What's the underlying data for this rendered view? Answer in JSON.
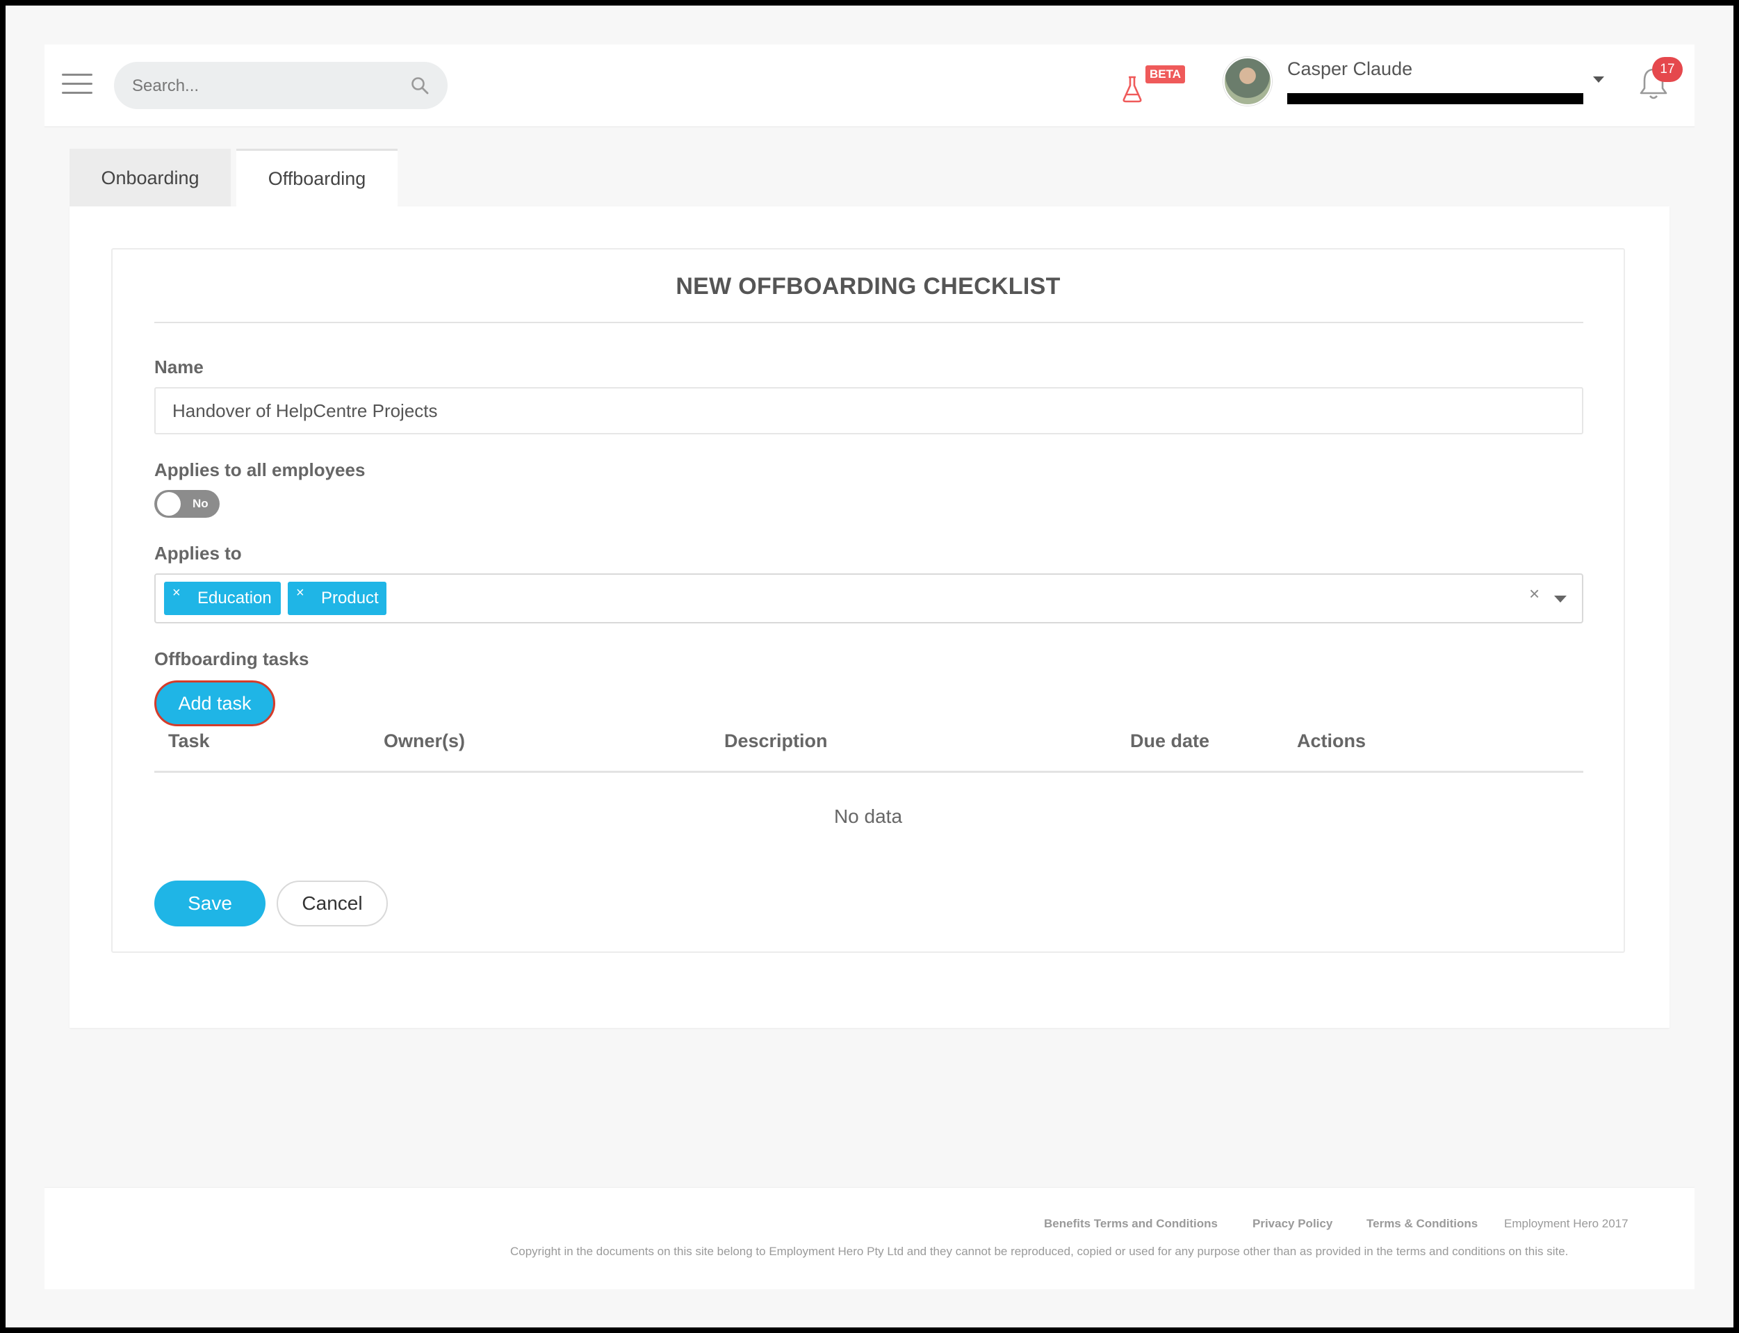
{
  "header": {
    "search_placeholder": "Search...",
    "beta_label": "BETA",
    "user_name": "Casper Claude",
    "notification_count": "17"
  },
  "tabs": [
    {
      "label": "Onboarding",
      "active": false
    },
    {
      "label": "Offboarding",
      "active": true
    }
  ],
  "form": {
    "title": "NEW OFFBOARDING CHECKLIST",
    "name_label": "Name",
    "name_value": "Handover of HelpCentre Projects",
    "applies_all_label": "Applies to all employees",
    "applies_all_toggle": "No",
    "applies_to_label": "Applies to",
    "applies_to_chips": [
      "Education",
      "Product"
    ],
    "chip_remove_symbol": "×",
    "clear_symbol": "×",
    "tasks_label": "Offboarding tasks",
    "add_task_button": "Add task",
    "table_headers": [
      "Task",
      "Owner(s)",
      "Description",
      "Due date",
      "Actions"
    ],
    "empty_text": "No data",
    "save_button": "Save",
    "cancel_button": "Cancel"
  },
  "footer": {
    "links": [
      "Benefits Terms and Conditions",
      "Privacy Policy",
      "Terms & Conditions"
    ],
    "year_text": "Employment Hero 2017",
    "copyright": "Copyright in the documents on this site belong to Employment Hero Pty Ltd and they cannot be reproduced, copied or used for any purpose other than as provided in the terms and conditions on this site."
  },
  "colors": {
    "accent": "#1fb5e6",
    "badge_red": "#e5484d",
    "beta_red": "#ef5a5a",
    "highlight_outline": "#d43c2b"
  }
}
